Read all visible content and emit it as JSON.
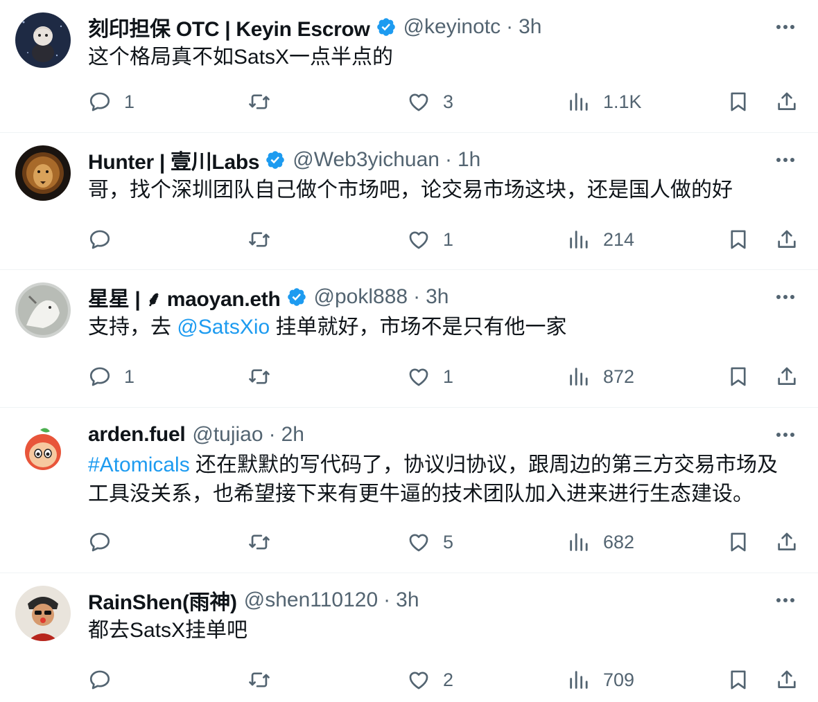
{
  "tweets": [
    {
      "name": "刻印担保 OTC | Keyin Escrow",
      "verified": true,
      "handle": "@keyinotc",
      "dot": "·",
      "time": "3h",
      "text": [
        {
          "t": "这个格局真不如SatsX一点半点的",
          "link": false
        }
      ],
      "replies": "1",
      "retweets": "",
      "likes": "3",
      "views": "1.1K"
    },
    {
      "name": "Hunter | 壹川Labs",
      "verified": true,
      "handle": "@Web3yichuan",
      "dot": "·",
      "time": "1h",
      "text": [
        {
          "t": "哥，找个深圳团队自己做个市场吧，论交易市场这块，还是国人做的好",
          "link": false
        }
      ],
      "replies": "",
      "retweets": "",
      "likes": "1",
      "views": "214"
    },
    {
      "name": "星星 | ⸙ maoyan.eth",
      "verified": true,
      "handle": "@pokl888",
      "dot": "·",
      "time": "3h",
      "text": [
        {
          "t": "支持，去 ",
          "link": false
        },
        {
          "t": "@SatsXio",
          "link": true
        },
        {
          "t": " 挂单就好，市场不是只有他一家",
          "link": false
        }
      ],
      "replies": "1",
      "retweets": "",
      "likes": "1",
      "views": "872"
    },
    {
      "name": "arden.fuel",
      "verified": false,
      "handle": "@tujiao",
      "dot": "·",
      "time": "2h",
      "text": [
        {
          "t": "#Atomicals",
          "link": true
        },
        {
          "t": " 还在默默的写代码了，协议归协议，跟周边的第三方交易市场及工具没关系，也希望接下来有更牛逼的技术团队加入进来进行生态建设。",
          "link": false
        }
      ],
      "replies": "",
      "retweets": "",
      "likes": "5",
      "views": "682"
    },
    {
      "name": "RainShen(雨神)",
      "verified": false,
      "handle": "@shen110120",
      "dot": "·",
      "time": "3h",
      "text": [
        {
          "t": "都去SatsX挂单吧",
          "link": false
        }
      ],
      "replies": "",
      "retweets": "",
      "likes": "2",
      "views": "709"
    }
  ],
  "icons": {
    "reply": "reply-icon",
    "retweet": "retweet-icon",
    "like": "heart-icon",
    "views": "views-bar-chart-icon",
    "bookmark": "bookmark-icon",
    "share": "share-upload-icon",
    "more": "more-dots-icon",
    "verified": "verified-badge-icon"
  },
  "colors": {
    "link": "#1d9bf0",
    "secondary": "#536471",
    "verified": "#1d9bf0",
    "divider": "#eff3f4"
  }
}
